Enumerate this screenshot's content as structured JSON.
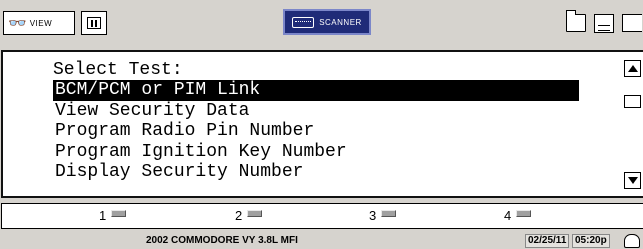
{
  "toolbar": {
    "view_label": "VIEW",
    "scanner_label": "SCANNER",
    "icons": [
      "binoculars-icon",
      "pause-icon",
      "scanner-icon",
      "folder-icon",
      "document-icon",
      "print-icon"
    ]
  },
  "menu": {
    "title": "Select Test:",
    "items": [
      "BCM/PCM or PIM Link",
      "View Security Data",
      "Program Radio Pin Number",
      "Program Ignition Key Number",
      "Display Security Number"
    ],
    "selected_index": 0
  },
  "function_keys": [
    "1",
    "2",
    "3",
    "4"
  ],
  "status": {
    "vehicle": "2002 COMMODORE VY 3.8L MFI",
    "date": "02/25/11",
    "time": "05:20p"
  },
  "colors": {
    "background": "#d6d3ce",
    "scanner_button": "#1f2b78",
    "selection": "#000000"
  }
}
